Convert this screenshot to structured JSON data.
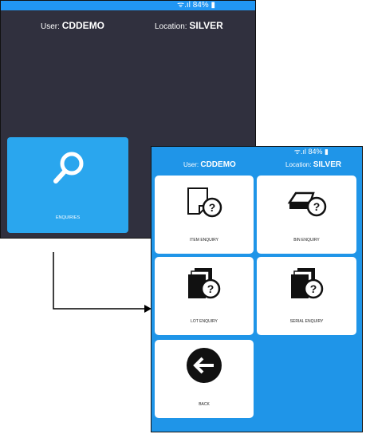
{
  "status": {
    "battery": "84%"
  },
  "screen1": {
    "user_label": "User:",
    "user_value": "CDDEMO",
    "location_label": "Location:",
    "location_value": "SILVER",
    "tile_label": "ENQUIRIES"
  },
  "screen2": {
    "user_label": "User:",
    "user_value": "CDDEMO",
    "location_label": "Location:",
    "location_value": "SILVER",
    "tiles": [
      {
        "label": "ITEM ENQUIRY"
      },
      {
        "label": "BIN ENQUIRY"
      },
      {
        "label": "LOT ENQUIRY"
      },
      {
        "label": "SERIAL ENQUIRY"
      },
      {
        "label": "BACK"
      }
    ]
  },
  "colors": {
    "accent": "#2196f3",
    "dark": "#30303e",
    "tile": "#2aa6ee",
    "screen2_bg": "#1f95e8"
  }
}
